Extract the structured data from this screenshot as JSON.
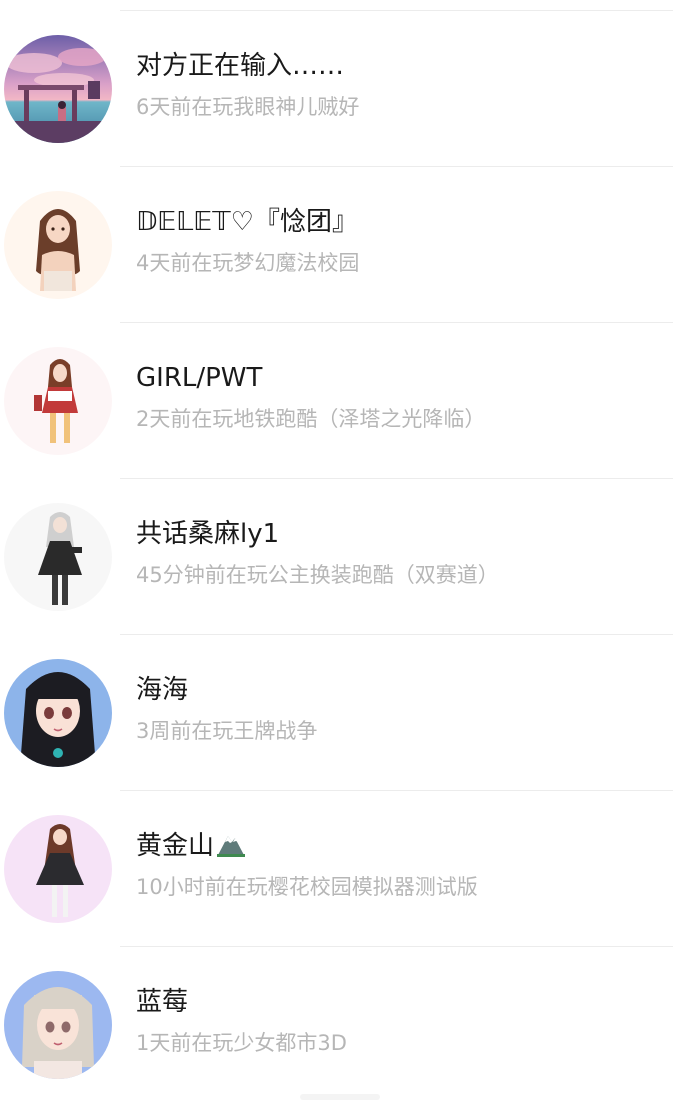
{
  "friends": [
    {
      "name": "对方正在输入……",
      "status": "6天前在玩我眼神儿贼好",
      "avatar_icon": "sunset-pier-avatar-icon",
      "name_emoji": ""
    },
    {
      "name": "𝔻𝔼𝕃𝔼𝕋♡『惗团』",
      "status": "4天前在玩梦幻魔法校园",
      "avatar_icon": "girl-long-hair-avatar-icon",
      "name_emoji": ""
    },
    {
      "name": "GIRL/PWT",
      "status": "2天前在玩地铁跑酷（泽塔之光降临）",
      "avatar_icon": "girl-red-dress-avatar-icon",
      "name_emoji": ""
    },
    {
      "name": "共话桑麻ly1",
      "status": "45分钟前在玩公主换装跑酷（双赛道）",
      "avatar_icon": "girl-black-dress-avatar-icon",
      "name_emoji": ""
    },
    {
      "name": "海海",
      "status": "3周前在玩王牌战争",
      "avatar_icon": "anime-girl-black-hair-avatar-icon",
      "name_emoji": ""
    },
    {
      "name": "黄金山",
      "status": "10小时前在玩樱花校园模拟器测试版",
      "avatar_icon": "girl-pink-bg-avatar-icon",
      "name_emoji": "mountain"
    },
    {
      "name": "蓝莓",
      "status": "1天前在玩少女都市3D",
      "avatar_icon": "anime-girl-silver-hair-avatar-icon",
      "name_emoji": ""
    }
  ]
}
